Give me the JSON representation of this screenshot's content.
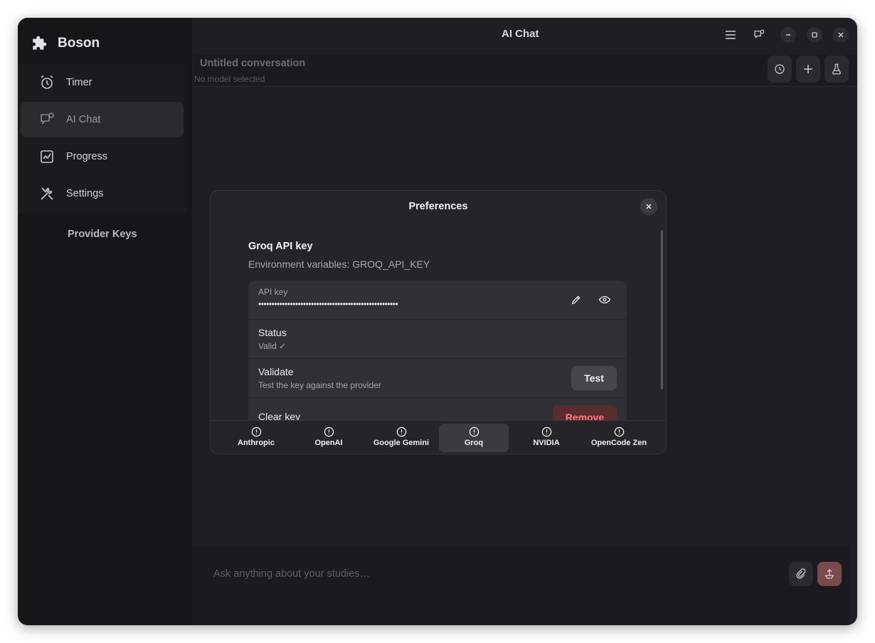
{
  "app": {
    "name": "Boson",
    "window_title": "AI Chat"
  },
  "sidebar": {
    "items": [
      {
        "label": "Timer",
        "icon": "alarm-clock-icon"
      },
      {
        "label": "AI Chat",
        "icon": "chat-bubble-icon",
        "active": true
      },
      {
        "label": "Progress",
        "icon": "chart-icon"
      },
      {
        "label": "Settings",
        "icon": "tools-icon"
      }
    ],
    "sub_item": "Provider Keys"
  },
  "conversation": {
    "title": "Untitled conversation",
    "model_status": "No model selected"
  },
  "composer": {
    "placeholder": "Ask anything about your studies…"
  },
  "dialog": {
    "title": "Preferences",
    "section_title": "Groq API key",
    "section_subtitle": "Environment variables: GROQ_API_KEY",
    "api_key": {
      "label": "API key",
      "value": "•••••••••••••••••••••••••••••••••••••••••••••••••••••"
    },
    "status": {
      "title": "Status",
      "value": "Valid ✓"
    },
    "validate": {
      "title": "Validate",
      "subtitle": "Test the key against the provider",
      "button": "Test"
    },
    "clear": {
      "title": "Clear key",
      "button": "Remove"
    },
    "tabs": [
      {
        "label": "Anthropic"
      },
      {
        "label": "OpenAI"
      },
      {
        "label": "Google Gemini"
      },
      {
        "label": "Groq",
        "active": true
      },
      {
        "label": "NVIDIA"
      },
      {
        "label": "OpenCode Zen"
      }
    ]
  },
  "colors": {
    "window_bg": "#1f1f23",
    "sidebar_bg": "#16161a",
    "danger": "#ff7b7f",
    "danger_bg": "#5a2c2e"
  }
}
